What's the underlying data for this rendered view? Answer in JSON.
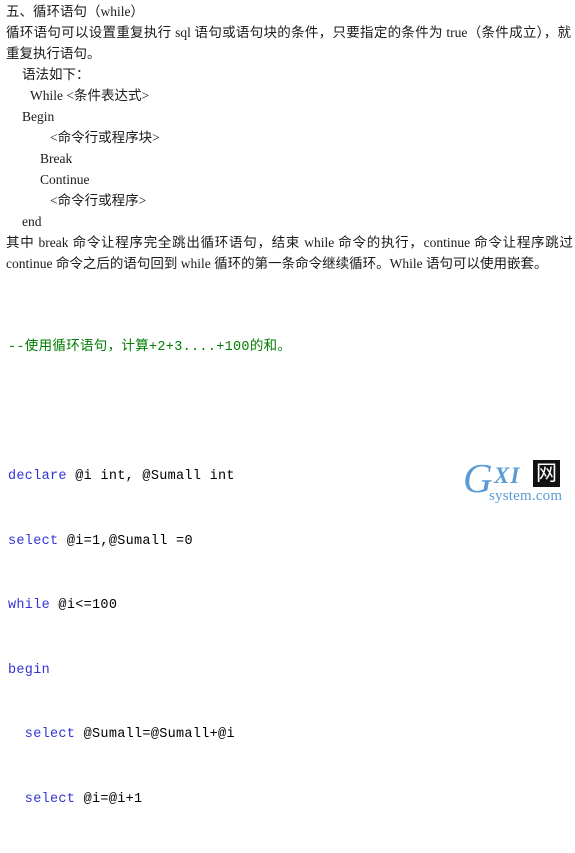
{
  "document": {
    "heading": "五、循环语句（while）",
    "intro_paragraph": "循环语句可以设置重复执行 sql  语句或语句块的条件，只要指定的条件为 true（条件成立），就重复执行语句。",
    "syntax_label": "语法如下：",
    "syntax_lines": [
      {
        "text": "While <条件表达式>",
        "indent": 1
      },
      {
        "text": "Begin",
        "indent": 0
      },
      {
        "text": "<命令行或程序块>",
        "indent": 3
      },
      {
        "text": "Break",
        "indent": 2
      },
      {
        "text": "Continue",
        "indent": 2
      },
      {
        "text": "<命令行或程序>",
        "indent": 3
      },
      {
        "text": "end",
        "indent": 0
      }
    ],
    "explanation_paragraph": "其中 break  命令让程序完全跳出循环语句，结束 while 命令的执行，continue 命令让程序跳过 continue  命令之后的语句回到 while 循环的第一条命令继续循环。While 语句可以使用嵌套。",
    "code": {
      "comment_line": "--使用循环语句，计算+2+3....+100的和。",
      "lines": [
        {
          "kw1": "declare",
          "rest": " @i int, @Sumall int"
        },
        {
          "kw1": "select",
          "rest": " @i=1,@Sumall =0"
        },
        {
          "kw1": "while",
          "rest": " @i<=100"
        },
        {
          "kw1": "begin",
          "rest": ""
        },
        {
          "kw1": "  select",
          "rest": " @Sumall=@Sumall+@i"
        },
        {
          "kw1": "  select",
          "rest": " @i=@i+1"
        }
      ]
    }
  },
  "watermark": {
    "letter_g": "G",
    "letters_xi": "XI",
    "char_box": "网",
    "domain": "system.com"
  },
  "colors": {
    "comment_green": "#007d00",
    "keyword_blue": "#3434d6",
    "text_black": "#1a1a1a",
    "watermark_blue": "#5b9bd5",
    "background": "#ffffff"
  }
}
